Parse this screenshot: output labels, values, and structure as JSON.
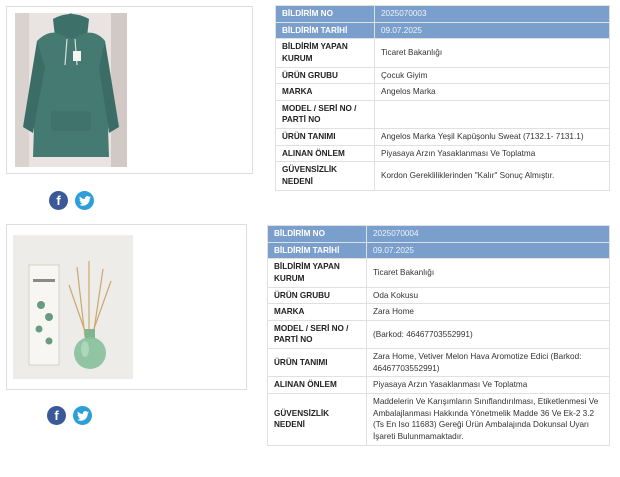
{
  "labels": {
    "no": "BİLDİRİM NO",
    "date": "BİLDİRİM TARİHİ",
    "org": "BİLDİRİM YAPAN KURUM",
    "group": "ÜRÜN GRUBU",
    "brand": "MARKA",
    "model": "MODEL / SERİ NO / PARTİ NO",
    "desc": "ÜRÜN TANIMI",
    "measure": "ALINAN ÖNLEM",
    "reason": "GÜVENSİZLİK NEDENİ"
  },
  "social": {
    "facebook": "f",
    "twitter_icon": "twitter-bird-icon"
  },
  "records": [
    {
      "no": "2025070003",
      "date": "09.07.2025",
      "org": "Ticaret Bakanlığı",
      "group": "Çocuk Giyim",
      "brand": "Angelos Marka",
      "model": "",
      "desc": "Angelos Marka Yeşil Kapüşonlu Sweat (7132.1- 7131.1)",
      "measure": "Piyasaya Arzın Yasaklanması Ve Toplatma",
      "reason": "Kordon Gerekliliklerinden \"Kalır\" Sonuç Almıştır.",
      "image": "green hooded sweatshirt on hanger"
    },
    {
      "no": "2025070004",
      "date": "09.07.2025",
      "org": "Ticaret Bakanlığı",
      "group": "Oda Kokusu",
      "brand": "Zara Home",
      "model": "(Barkod: 46467703552991)",
      "desc": "Zara Home, Vetiver Melon Hava Aromotize Edici (Barkod: 46467703552991)",
      "measure": "Piyasaya Arzın Yasaklanması Ve Toplatma",
      "reason": "Maddelerin Ve Karışımların Sınıflandırılması, Etiketlenmesi Ve Ambalajlanması Hakkında Yönetmelik Madde 36 Ve Ek-2 3.2 (Ts En Iso 11683) Gereği Ürün Ambalajında Dokunsal Uyarı İşareti Bulunmamaktadır.",
      "image": "reed diffuser bottle with sticks and box"
    }
  ]
}
